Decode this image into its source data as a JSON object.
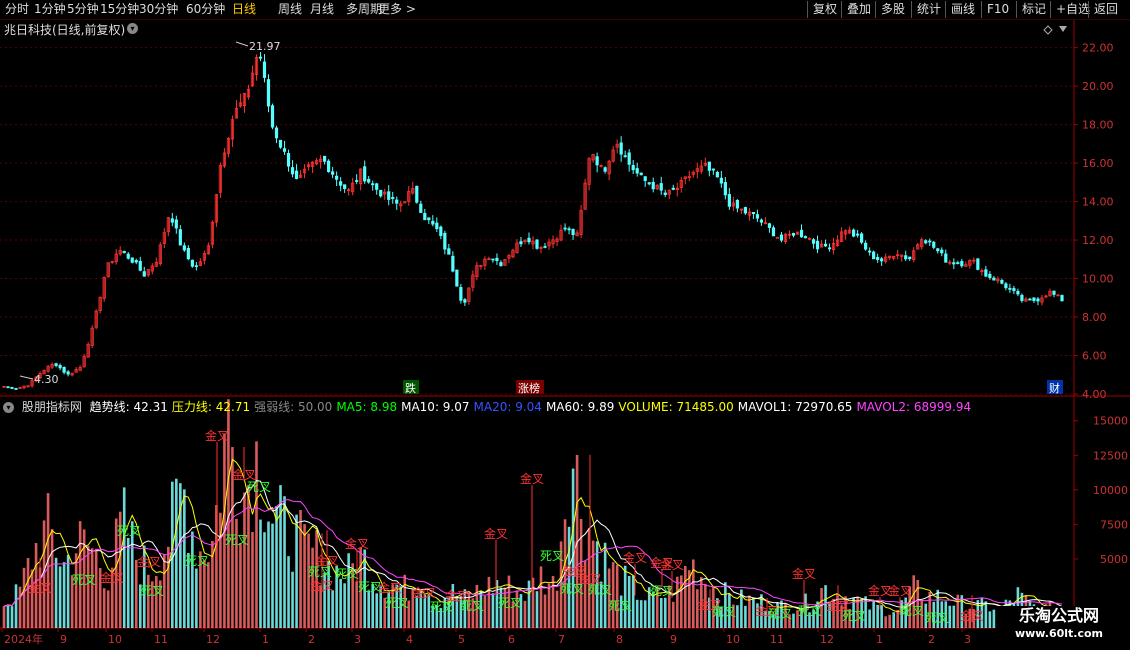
{
  "toolbar": {
    "left_items": [
      "分时",
      "1分钟",
      "5分钟",
      "15分钟",
      "30分钟",
      "60分钟",
      "日线",
      "周线",
      "月线",
      "多周期",
      "更多 >"
    ],
    "active": "日线",
    "right_items": [
      "复权",
      "叠加",
      "多股",
      "统计",
      "画线",
      "F10",
      "标记",
      "+自选",
      "返回"
    ]
  },
  "title": "兆日科技(日线,前复权)",
  "price_axis_ticks": [
    "22.00",
    "20.00",
    "18.00",
    "16.00",
    "14.00",
    "12.00",
    "10.00",
    "8.00",
    "6.00",
    "4.00"
  ],
  "volume_axis_ticks": [
    "15000",
    "12500",
    "10000",
    "7500",
    "5000"
  ],
  "date_axis": [
    "2024年",
    "9",
    "10",
    "11",
    "12",
    "1",
    "2",
    "3",
    "4",
    "5",
    "6",
    "7",
    "8",
    "9",
    "10",
    "11",
    "12",
    "1",
    "2",
    "3"
  ],
  "annotations": {
    "high_label": "21.97",
    "low_label": "4.30",
    "event_down": "跌",
    "event_up": "涨榜",
    "event_fin": "财"
  },
  "indicator": {
    "name": "股朋指标网",
    "values": [
      {
        "label": "趋势线:",
        "value": "42.31",
        "color": "#ffffff"
      },
      {
        "label": "压力线:",
        "value": "42.71",
        "color": "#ffff00"
      },
      {
        "label": "强弱线:",
        "value": "50.00",
        "color": "#888888"
      },
      {
        "label": "MA5:",
        "value": "8.98",
        "color": "#00ff00"
      },
      {
        "label": "MA10:",
        "value": "9.07",
        "color": "#ffffff"
      },
      {
        "label": "MA20:",
        "value": "9.04",
        "color": "#3355ff"
      },
      {
        "label": "MA60:",
        "value": "9.89",
        "color": "#ffffff"
      },
      {
        "label": "VOLUME:",
        "value": "71485.00",
        "color": "#ffff00"
      },
      {
        "label": "MAVOL1:",
        "value": "72970.65",
        "color": "#ffffff"
      },
      {
        "label": "MAVOL2:",
        "value": "68999.94",
        "color": "#ff44ff"
      }
    ]
  },
  "signal_labels": {
    "golden": "金叉",
    "death": "死叉"
  },
  "watermark": {
    "line1": "乐淘公式网",
    "line2": "www.60lt.com"
  },
  "colors": {
    "up": "#ff3232",
    "down": "#54ffff",
    "grid": "#5a0000",
    "axis": "#a00000"
  },
  "chart_data": {
    "type": "candlestick",
    "price_ylim": [
      4.0,
      22.5
    ],
    "volume_ylim": [
      0,
      16500
    ],
    "price_path": [
      4.4,
      4.3,
      4.5,
      5.2,
      5.6,
      5.0,
      5.4,
      7.5,
      10.5,
      11.5,
      11.0,
      10.2,
      11.0,
      13.5,
      11.5,
      10.5,
      11.5,
      16.0,
      18.5,
      19.5,
      21.97,
      18.0,
      16.5,
      15.0,
      15.8,
      16.2,
      15.3,
      14.5,
      15.5,
      14.8,
      14.2,
      13.8,
      14.6,
      13.2,
      12.5,
      11.0,
      8.6,
      10.5,
      11.2,
      10.8,
      11.6,
      12.2,
      11.6,
      12.0,
      12.6,
      12.2,
      16.8,
      15.5,
      17.2,
      16.0,
      15.2,
      14.8,
      14.3,
      14.8,
      15.5,
      15.8,
      15.2,
      13.8,
      13.5,
      13.2,
      12.6,
      12.0,
      12.4,
      12.2,
      11.6,
      11.8,
      12.6,
      12.1,
      11.2,
      10.9,
      11.4,
      11.0,
      12.2,
      11.6,
      10.9,
      10.8,
      10.9,
      10.2,
      9.9,
      9.4,
      8.8,
      8.9,
      9.3,
      8.9
    ],
    "volume_path": [
      1800,
      2500,
      5500,
      7200,
      4500,
      6200,
      5600,
      3800,
      7800,
      4800,
      4200,
      6600,
      10200,
      5500,
      6200,
      15000,
      9500,
      12500,
      8000,
      7200,
      6000,
      5300,
      4200,
      3800,
      5200,
      3600,
      3200,
      2800,
      3800,
      1900,
      2600,
      2100,
      2800,
      3200,
      2900,
      2500,
      3800,
      3000,
      13000,
      7800,
      5600,
      3900,
      3000,
      2200,
      2300,
      2600,
      4800,
      3600,
      2600,
      2100,
      2000,
      1900,
      1500,
      1700,
      1800,
      2900,
      2500,
      2100,
      1600,
      1400,
      1300,
      2800,
      2300,
      2200,
      1800,
      1600,
      1600,
      1400,
      2400,
      1500,
      1400,
      1300
    ]
  }
}
